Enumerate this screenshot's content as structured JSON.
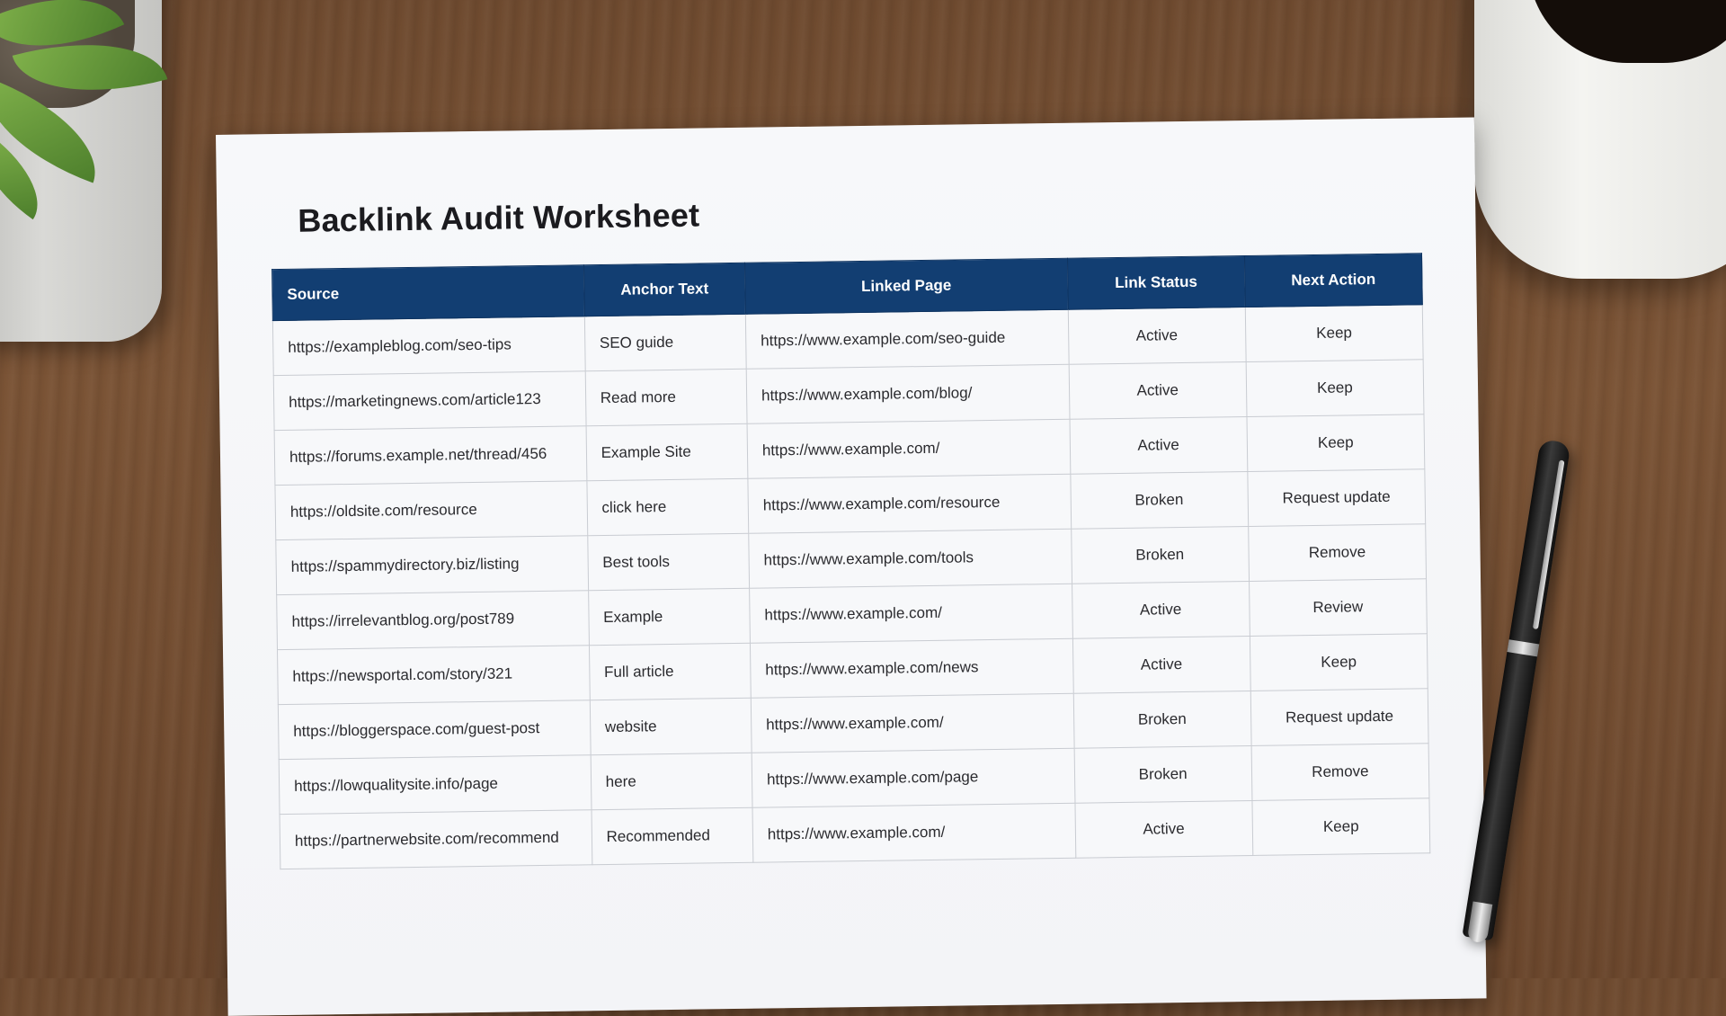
{
  "document": {
    "title": "Backlink Audit Worksheet"
  },
  "table": {
    "headers": [
      "Source",
      "Anchor Text",
      "Linked Page",
      "Link Status",
      "Next Action"
    ],
    "rows": [
      {
        "source": "https://exampleblog.com/seo-tips",
        "anchor": "SEO guide",
        "linked": "https://www.example.com/seo-guide",
        "status": "Active",
        "action": "Keep"
      },
      {
        "source": "https://marketingnews.com/article123",
        "anchor": "Read more",
        "linked": "https://www.example.com/blog/",
        "status": "Active",
        "action": "Keep"
      },
      {
        "source": "https://forums.example.net/thread/456",
        "anchor": "Example Site",
        "linked": "https://www.example.com/",
        "status": "Active",
        "action": "Keep"
      },
      {
        "source": "https://oldsite.com/resource",
        "anchor": "click here",
        "linked": "https://www.example.com/resource",
        "status": "Broken",
        "action": "Request update"
      },
      {
        "source": "https://spammydirectory.biz/listing",
        "anchor": "Best tools",
        "linked": "https://www.example.com/tools",
        "status": "Broken",
        "action": "Remove"
      },
      {
        "source": "https://irrelevantblog.org/post789",
        "anchor": "Example",
        "linked": "https://www.example.com/",
        "status": "Active",
        "action": "Review"
      },
      {
        "source": "https://newsportal.com/story/321",
        "anchor": "Full article",
        "linked": "https://www.example.com/news",
        "status": "Active",
        "action": "Keep"
      },
      {
        "source": "https://bloggerspace.com/guest-post",
        "anchor": "website",
        "linked": "https://www.example.com/",
        "status": "Broken",
        "action": "Request update"
      },
      {
        "source": "https://lowqualitysite.info/page",
        "anchor": "here",
        "linked": "https://www.example.com/page",
        "status": "Broken",
        "action": "Remove"
      },
      {
        "source": "https://partnerwebsite.com/recommend",
        "anchor": "Recommended",
        "linked": "https://www.example.com/",
        "status": "Active",
        "action": "Keep"
      }
    ]
  },
  "colors": {
    "header_bg": "#123e72",
    "active": "#2e7d32",
    "broken": "#c62828"
  }
}
